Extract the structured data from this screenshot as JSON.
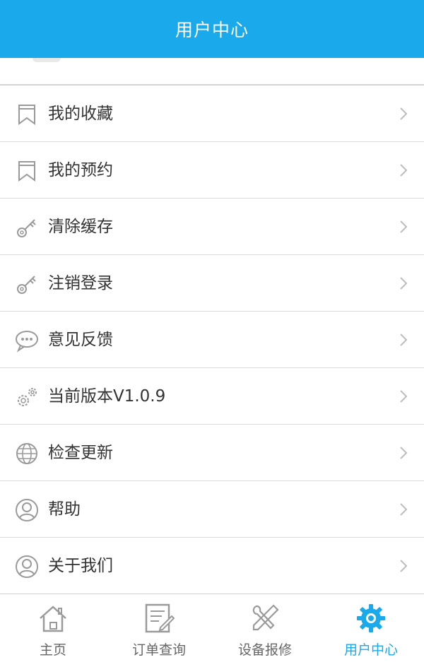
{
  "header": {
    "title": "用户中心"
  },
  "menu": {
    "items": [
      {
        "label": "我的收藏",
        "icon": "bookmark-icon"
      },
      {
        "label": "我的预约",
        "icon": "bookmark-icon"
      },
      {
        "label": "清除缓存",
        "icon": "key-icon"
      },
      {
        "label": "注销登录",
        "icon": "key-icon"
      },
      {
        "label": "意见反馈",
        "icon": "chat-bubble-icon"
      },
      {
        "label": "当前版本V1.0.9",
        "icon": "gears-icon"
      },
      {
        "label": "检查更新",
        "icon": "globe-icon"
      },
      {
        "label": "帮助",
        "icon": "user-icon"
      },
      {
        "label": "关于我们",
        "icon": "user-icon"
      }
    ]
  },
  "tabbar": {
    "tabs": [
      {
        "label": "主页",
        "icon": "home-icon",
        "active": false
      },
      {
        "label": "订单查询",
        "icon": "document-edit-icon",
        "active": false
      },
      {
        "label": "设备报修",
        "icon": "tools-icon",
        "active": false
      },
      {
        "label": "用户中心",
        "icon": "gear-icon",
        "active": true
      }
    ]
  },
  "colors": {
    "accent": "#1aaaec",
    "icon_gray": "#9a9a9a",
    "text": "#333333"
  }
}
